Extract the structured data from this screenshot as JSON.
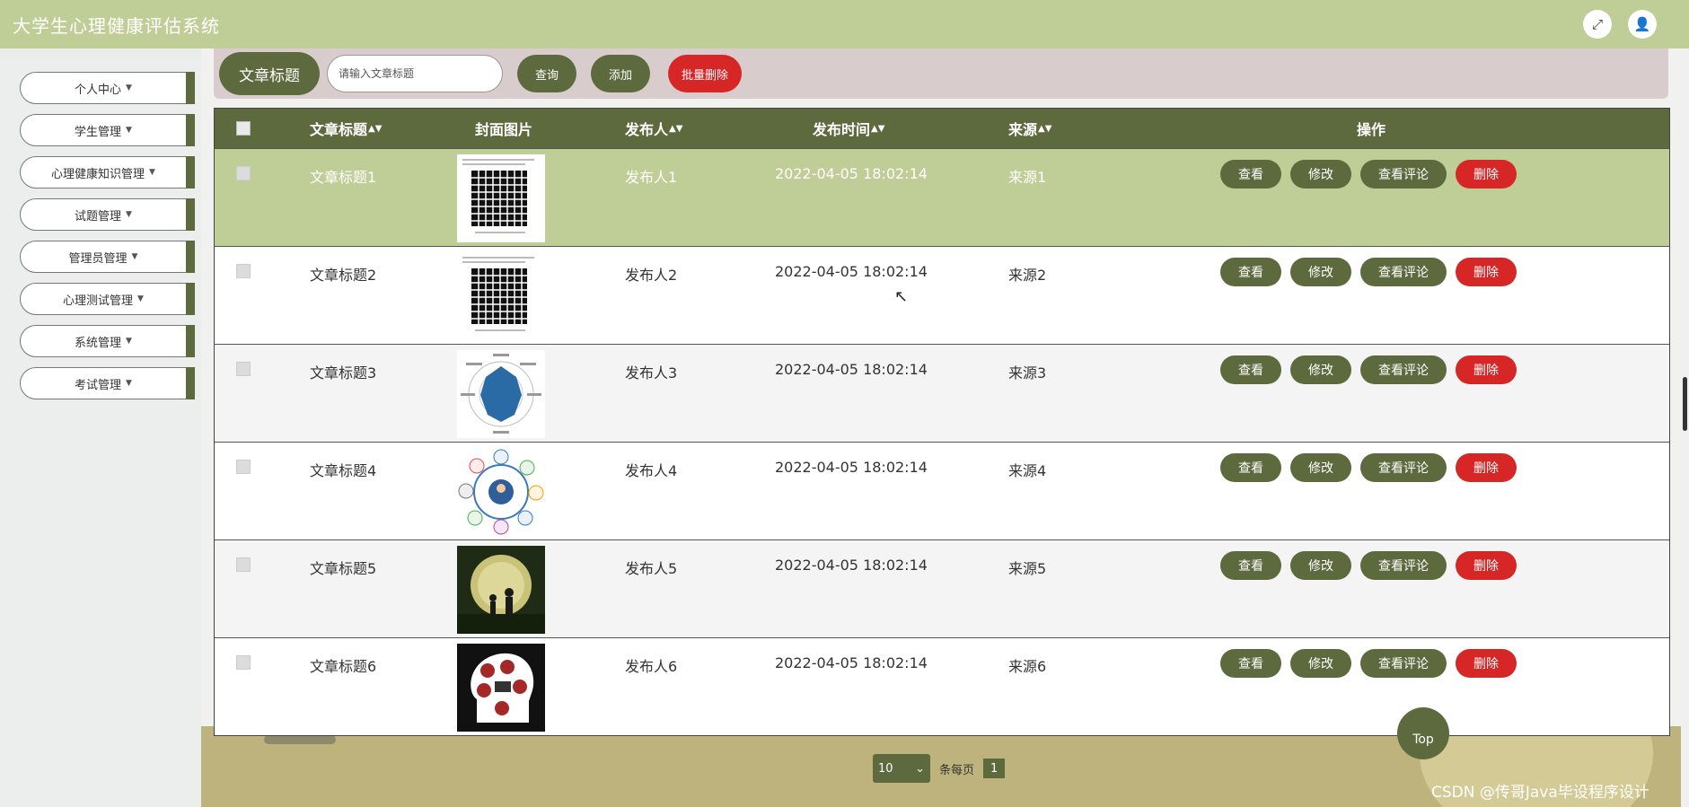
{
  "header": {
    "title": "大学生心理健康评估系统",
    "icons": [
      "fullscreen-icon",
      "user-icon"
    ]
  },
  "sidebar": {
    "items": [
      {
        "label": "个人中心"
      },
      {
        "label": "学生管理"
      },
      {
        "label": "心理健康知识管理"
      },
      {
        "label": "试题管理"
      },
      {
        "label": "管理员管理"
      },
      {
        "label": "心理测试管理"
      },
      {
        "label": "系统管理"
      },
      {
        "label": "考试管理"
      }
    ]
  },
  "search": {
    "label": "文章标题",
    "placeholder": "请输入文章标题",
    "query_button": "查询",
    "add_button": "添加",
    "batch_delete_button": "批量删除"
  },
  "table": {
    "columns": [
      "文章标题",
      "封面图片",
      "发布人",
      "发布时间",
      "来源",
      "操作"
    ],
    "rows": [
      {
        "title": "文章标题1",
        "publisher": "发布人1",
        "time": "2022-04-05 18:02:14",
        "source": "来源1",
        "thumb": "grid-illusion-image"
      },
      {
        "title": "文章标题2",
        "publisher": "发布人2",
        "time": "2022-04-05 18:02:14",
        "source": "来源2",
        "thumb": "grid-illusion-image"
      },
      {
        "title": "文章标题3",
        "publisher": "发布人3",
        "time": "2022-04-05 18:02:14",
        "source": "来源3",
        "thumb": "radar-chart-image"
      },
      {
        "title": "文章标题4",
        "publisher": "发布人4",
        "time": "2022-04-05 18:02:14",
        "source": "来源4",
        "thumb": "network-diagram-image"
      },
      {
        "title": "文章标题5",
        "publisher": "发布人5",
        "time": "2022-04-05 18:02:14",
        "source": "来源5",
        "thumb": "moon-silhouette-image"
      },
      {
        "title": "文章标题6",
        "publisher": "发布人6",
        "time": "2022-04-05 18:02:14",
        "source": "来源6",
        "thumb": "head-quiz-image"
      }
    ],
    "actions": {
      "view": "查看",
      "edit": "修改",
      "comments": "查看评论",
      "delete": "删除"
    }
  },
  "pagination": {
    "page_size": "10",
    "per_page_label": "条每页",
    "current_page": "1"
  },
  "top_button": "Top",
  "watermark": "CSDN @传哥Java毕设程序设计",
  "colors": {
    "header": "#bfcd96",
    "olive": "#5d6a3e",
    "danger": "#d72626"
  }
}
